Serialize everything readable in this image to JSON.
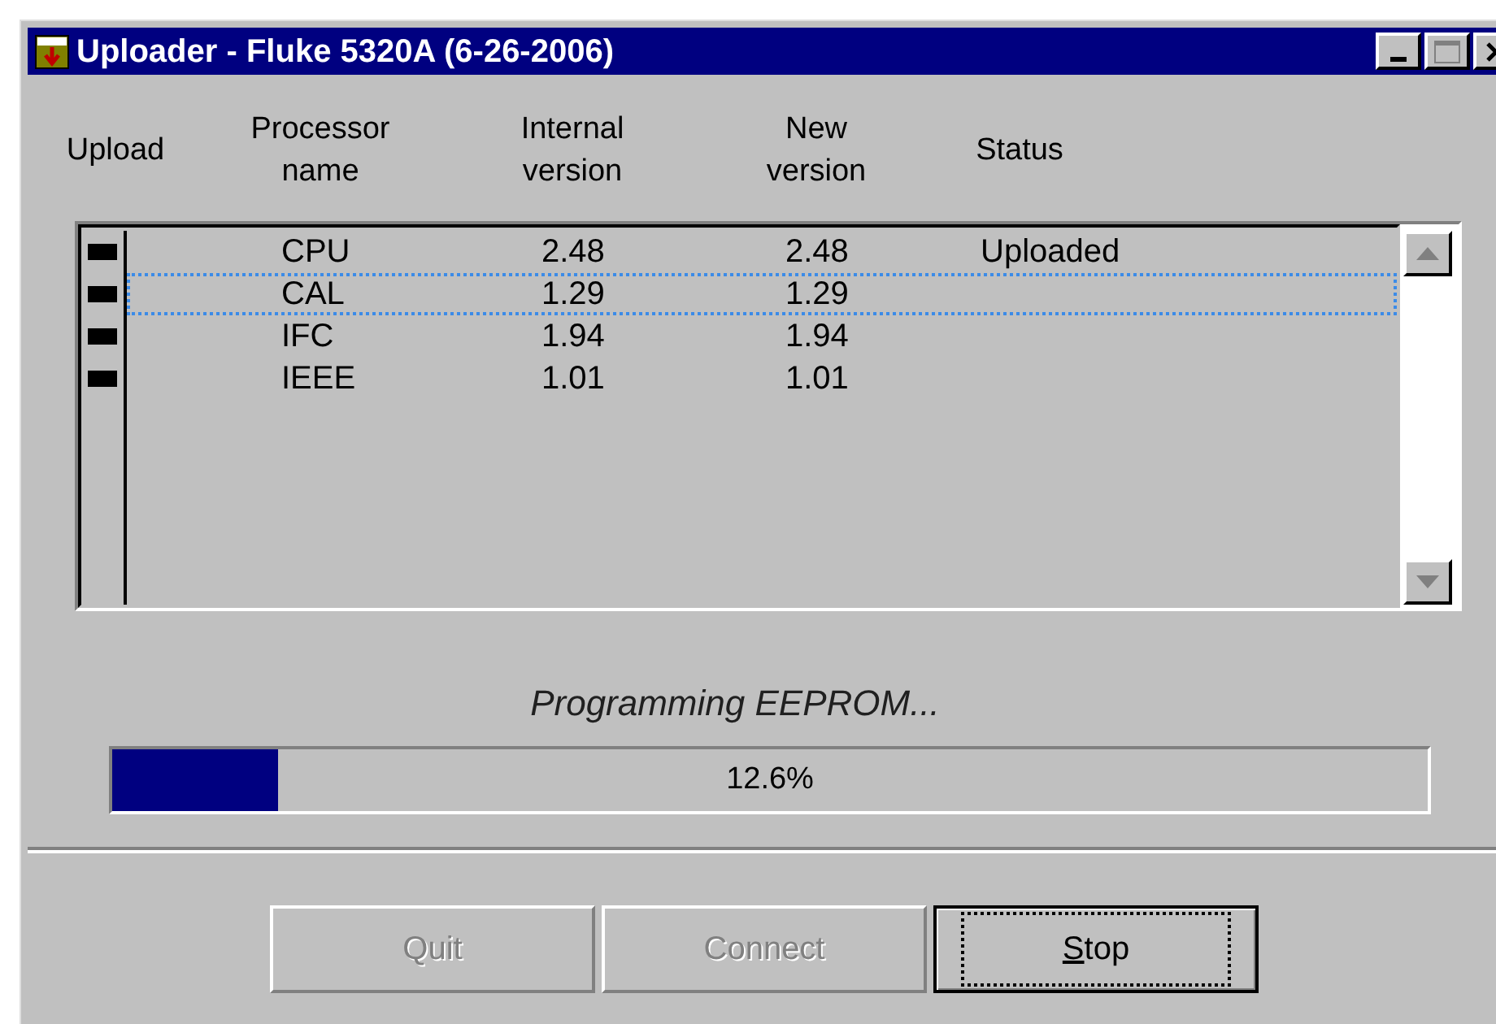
{
  "window": {
    "title": "Uploader - Fluke 5320A (6-26-2006)"
  },
  "columns": [
    {
      "label": "Upload"
    },
    {
      "label": "Processor name"
    },
    {
      "label": "Internal version"
    },
    {
      "label": "New version"
    },
    {
      "label": "Status"
    }
  ],
  "rows": [
    {
      "checked": true,
      "selected": false,
      "name": "CPU",
      "internal": "2.48",
      "new": "2.48",
      "status": "Uploaded"
    },
    {
      "checked": true,
      "selected": true,
      "name": "CAL",
      "internal": "1.29",
      "new": "1.29"
    },
    {
      "checked": true,
      "selected": false,
      "name": "IFC",
      "internal": "1.94",
      "new": "1.94"
    },
    {
      "checked": true,
      "selected": false,
      "name": "IEEE",
      "internal": "1.01",
      "new": "1.01"
    }
  ],
  "progress": {
    "caption": "Programming EEPROM...",
    "level": 0.126,
    "reading": "12.6%"
  },
  "buttons": [
    {
      "label": "Quit",
      "disabled": true,
      "default": false,
      "mnemonic": false
    },
    {
      "label": "Connect",
      "disabled": true,
      "default": false,
      "mnemonic": false
    },
    {
      "label": "Stop",
      "disabled": false,
      "default": true,
      "mnemonic": true
    }
  ]
}
